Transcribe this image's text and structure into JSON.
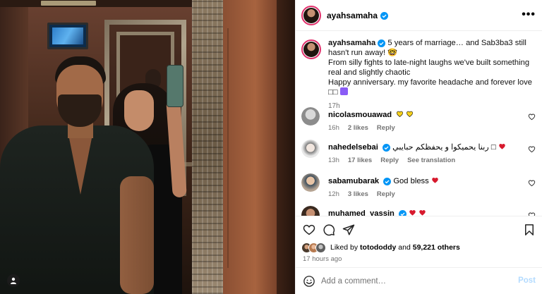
{
  "post": {
    "username": "ayahsamaha",
    "more_label": "•••"
  },
  "caption": {
    "username": "ayahsamaha",
    "line1": "5 years of marriage… and Sab3ba3 still hasn't run away! 🤓",
    "line2": "From silly fights to late-night laughs we've built something real and slightly chaotic",
    "line3": "Happy anniversary. my favorite headache and forever love □□",
    "time": "17h"
  },
  "comments": [
    {
      "username": "nicolasmouawad",
      "text": "",
      "time": "16h",
      "likes": "2 likes",
      "reply": "Reply",
      "translation": ""
    },
    {
      "username": "nahedelsebai",
      "text": "ربنا يحميكوا و يحفظكم حبايبي □",
      "time": "13h",
      "likes": "17 likes",
      "reply": "Reply",
      "translation": "See translation"
    },
    {
      "username": "sabamubarak",
      "text": "God bless",
      "time": "12h",
      "likes": "3 likes",
      "reply": "Reply",
      "translation": ""
    },
    {
      "username": "muhamed_yassin",
      "text": "",
      "time": "",
      "likes": "",
      "reply": "",
      "translation": ""
    }
  ],
  "likes": {
    "prefix": "Liked by",
    "first_user": "totododdy",
    "connector": "and",
    "others": "59,221 others"
  },
  "post_time": "17 hours ago",
  "comment_input": {
    "placeholder": "Add a comment…",
    "post_label": "Post"
  },
  "colors": {
    "verified": "#0095f6",
    "heart_red": "#ed4956",
    "story_ring": "#e1306c",
    "post_disabled": "#b3dbff"
  }
}
